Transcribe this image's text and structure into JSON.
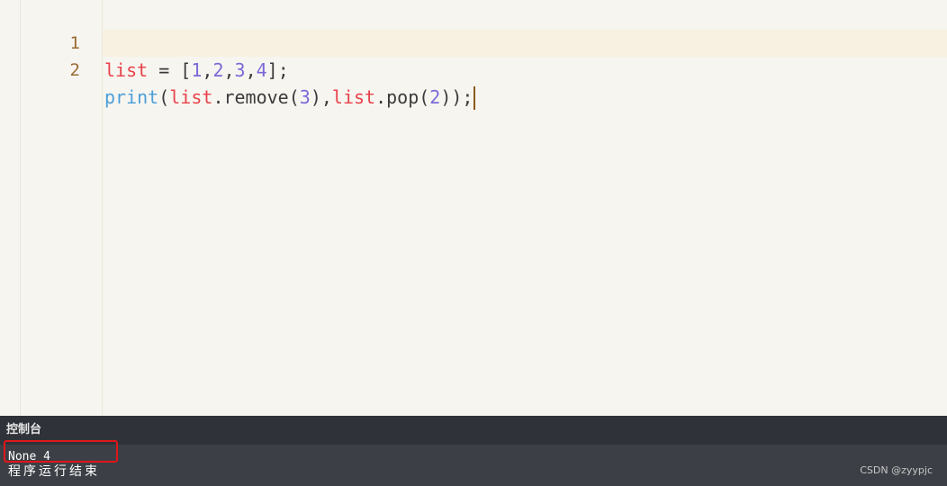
{
  "editor": {
    "lines": [
      {
        "number": "1",
        "tokens": [
          "list",
          " = ",
          "[",
          "1",
          ",",
          "2",
          ",",
          "3",
          ",",
          "4",
          "];"
        ]
      },
      {
        "number": "2",
        "tokens": [
          "print",
          "(",
          "list",
          ".remove(",
          "3",
          "),",
          "list",
          ".pop(",
          "2",
          "));"
        ]
      }
    ]
  },
  "console": {
    "title": "控制台",
    "output": "None 4",
    "status": "程序运行结束"
  },
  "watermark": "CSDN @zyypjc",
  "colors": {
    "editor_bg": "#f7f5f0",
    "active_line": "#f8f1e1",
    "line_number": "#9a6b34",
    "variable": "#e8414a",
    "number": "#7a6ad8",
    "function": "#4a9fd8",
    "console_bg": "#3c3f45",
    "console_header": "#2f3238",
    "highlight_border": "#e0161a"
  }
}
